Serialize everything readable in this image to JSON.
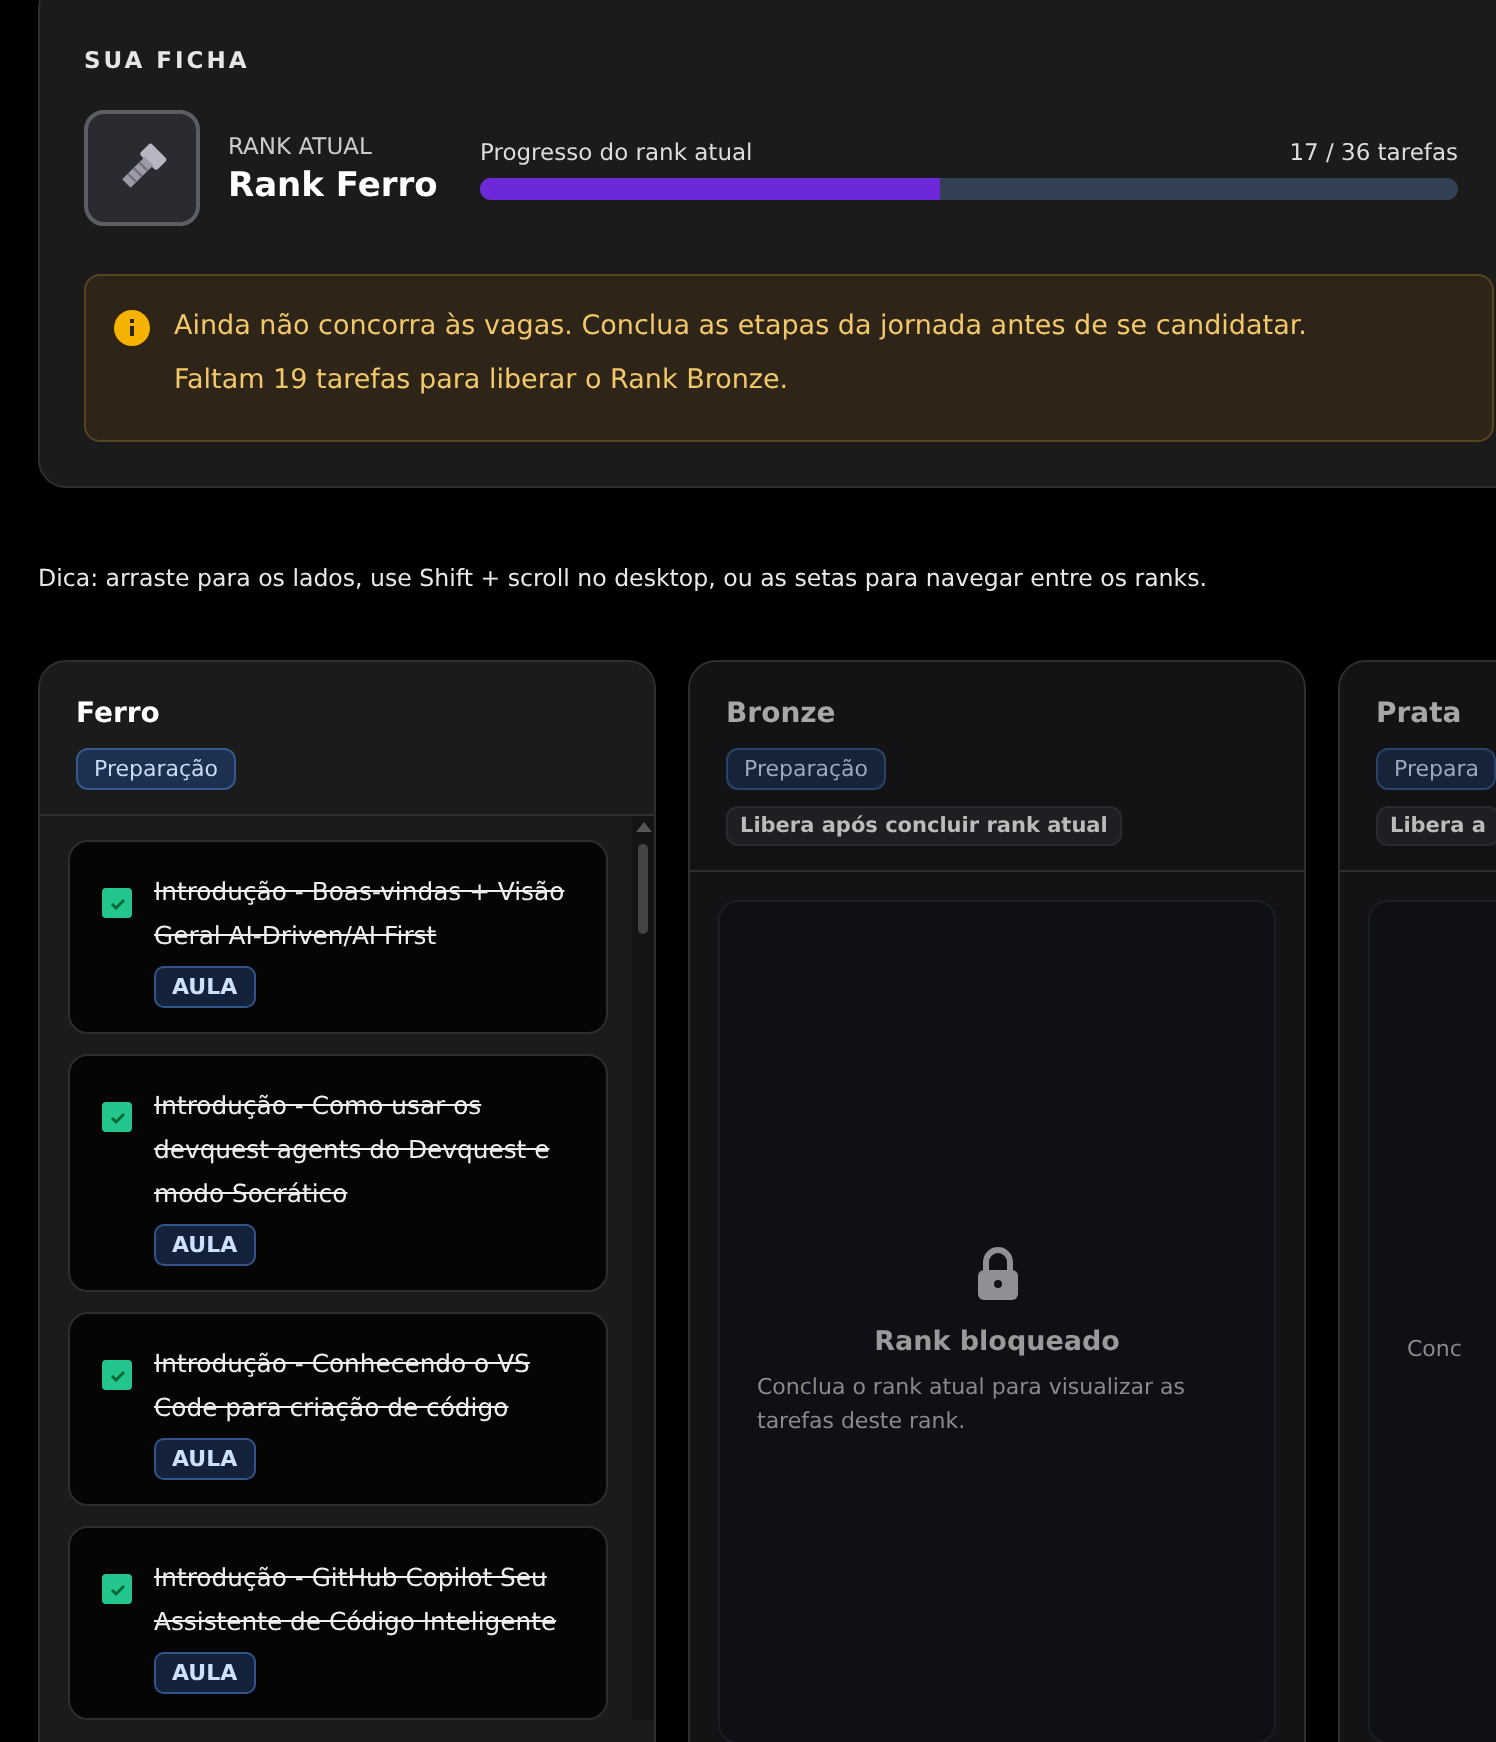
{
  "profile": {
    "title": "SUA FICHA",
    "rank_label": "RANK ATUAL",
    "rank_name": "Rank Ferro",
    "progress_label": "Progresso do rank atual",
    "progress_count": "17 / 36 tarefas",
    "level": 0.47
  },
  "alert": {
    "lines": [
      "Ainda não concorra às vagas. Conclua as etapas da jornada antes de se candidatar.",
      "Faltam 19 tarefas para liberar o Rank Bronze."
    ]
  },
  "hint": "Dica: arraste para os lados, use Shift + scroll no desktop, ou as setas para navegar entre os ranks.",
  "ranks": [
    {
      "name": "Ferro",
      "locked": false,
      "badges": [
        "Preparação"
      ],
      "tasks": [
        {
          "title": "Introdução - Boas-vindas + Visão Geral AI-Driven/AI First",
          "done": true,
          "tag": "AULA"
        },
        {
          "title": "Introdução - Como usar os devquest agents do Devquest e modo Socrático",
          "done": true,
          "tag": "AULA"
        },
        {
          "title": "Introdução - Conhecendo o VS Code para criação de código",
          "done": true,
          "tag": "AULA"
        },
        {
          "title": "Introdução - GitHub Copilot Seu Assistente de Código Inteligente",
          "done": true,
          "tag": "AULA"
        }
      ]
    },
    {
      "name": "Bronze",
      "locked": true,
      "badges": [
        "Preparação"
      ],
      "lock_note": "Libera após concluir rank atual",
      "lock_title": "Rank bloqueado",
      "lock_text": "Conclua o rank atual para visualizar as tarefas deste rank."
    },
    {
      "name": "Prata",
      "locked": true,
      "badges": [
        "Prepara"
      ],
      "lock_note": "Libera a",
      "lock_text": "Conc"
    }
  ]
}
